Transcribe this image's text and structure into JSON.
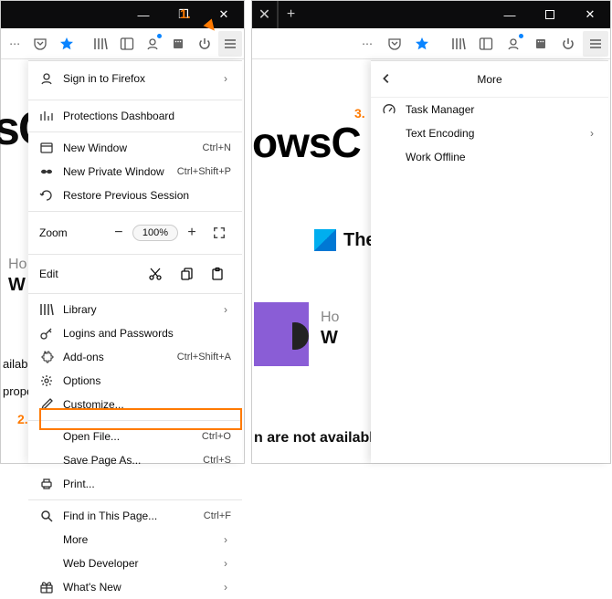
{
  "window": {
    "minimize_glyph": "—",
    "restore_glyph": "❐",
    "close_glyph": "✕",
    "tab_close_glyph": "✕",
    "tab_new_glyph": "+"
  },
  "toolbar": {
    "ellipsis": "⋯"
  },
  "menu": {
    "sign_in": "Sign in to Firefox",
    "protections": "Protections Dashboard",
    "new_window": "New Window",
    "new_window_sc": "Ctrl+N",
    "new_private": "New Private Window",
    "new_private_sc": "Ctrl+Shift+P",
    "restore_session": "Restore Previous Session",
    "zoom_label": "Zoom",
    "zoom_pct": "100%",
    "edit_label": "Edit",
    "library": "Library",
    "logins": "Logins and Passwords",
    "addons": "Add-ons",
    "addons_sc": "Ctrl+Shift+A",
    "options": "Options",
    "customize": "Customize...",
    "open_file": "Open File...",
    "open_file_sc": "Ctrl+O",
    "save_as": "Save Page As...",
    "save_as_sc": "Ctrl+S",
    "print": "Print...",
    "find": "Find in This Page...",
    "find_sc": "Ctrl+F",
    "more": "More",
    "web_dev": "Web Developer",
    "whats_new": "What's New"
  },
  "submenu": {
    "title": "More",
    "task_manager": "Task Manager",
    "text_encoding": "Text Encoding",
    "work_offline": "Work Offline"
  },
  "markers": {
    "m1": "1.",
    "m2": "2.",
    "m3": "3."
  },
  "bg": {
    "left_s": "sC",
    "ho": "Ho",
    "w": "W",
    "left_av": "ailabl",
    "left_prop": "prope",
    "right_ows": "owsC",
    "right_avail": "n are not availabl",
    "twc": "TheWindowsClub"
  }
}
